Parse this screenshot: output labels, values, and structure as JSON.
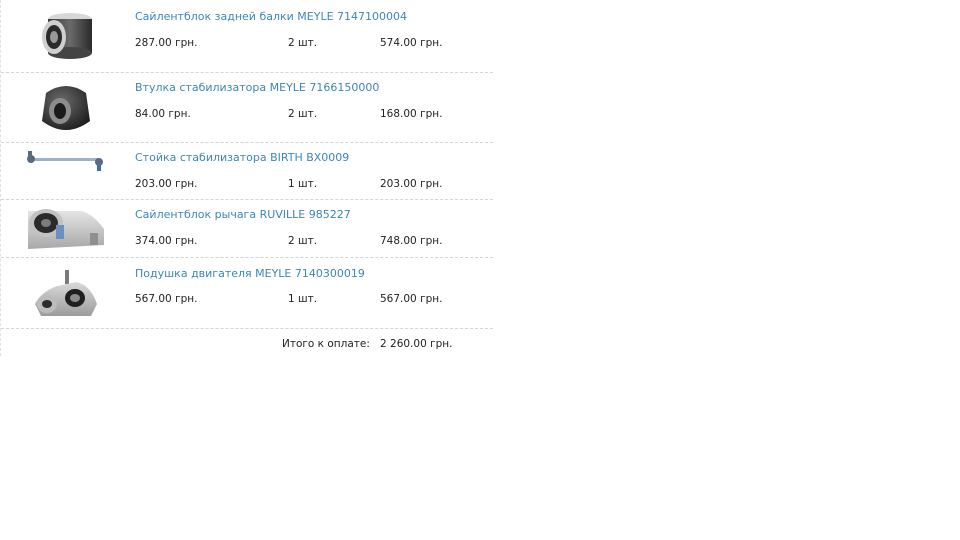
{
  "cart": {
    "items": [
      {
        "icon": "rear-beam-bushing-icon",
        "title": "Сайлентблок задней балки MEYLE 7147100004",
        "price": "287.00 грн.",
        "qty": "2 шт.",
        "sum": "574.00 грн."
      },
      {
        "icon": "stabilizer-bushing-icon",
        "title": "Втулка стабилизатора MEYLE 7166150000",
        "price": "84.00 грн.",
        "qty": "2 шт.",
        "sum": "168.00 грн."
      },
      {
        "icon": "stabilizer-link-icon",
        "title": "Стойка стабилизатора BIRTH BX0009",
        "price": "203.00 грн.",
        "qty": "1 шт.",
        "sum": "203.00 грн."
      },
      {
        "icon": "control-arm-bushing-icon",
        "title": "Сайлентблок рычага RUVILLE 985227",
        "price": "374.00 грн.",
        "qty": "2 шт.",
        "sum": "748.00 грн."
      },
      {
        "icon": "engine-mount-icon",
        "title": "Подушка двигателя MEYLE 7140300019",
        "price": "567.00 грн.",
        "qty": "1 шт.",
        "sum": "567.00 грн."
      }
    ],
    "total_label": "Итого к оплате:",
    "total_value": "2 260.00 грн."
  }
}
